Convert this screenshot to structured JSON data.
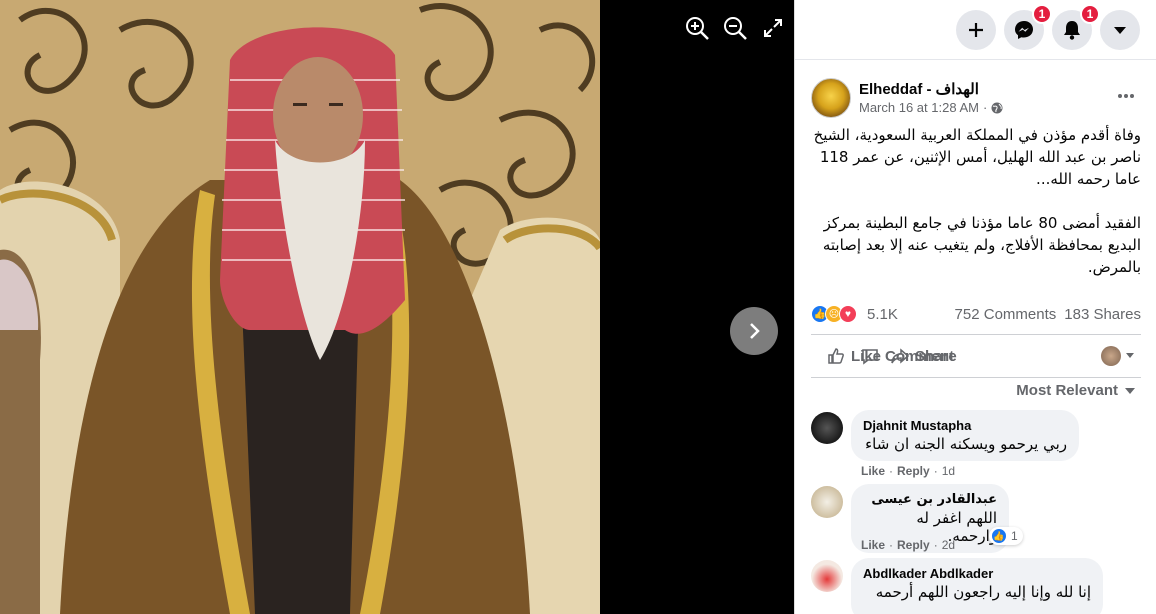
{
  "viewer": {
    "zoom_in_label": "zoom in",
    "zoom_out_label": "zoom out",
    "fullscreen_label": "fullscreen",
    "next_label": "next photo"
  },
  "topbar": {
    "messenger_badge": "1",
    "notifications_badge": "1"
  },
  "post": {
    "page_name": "Elheddaf - الهداف",
    "time": "March 16 at 1:28 AM",
    "separator": "·",
    "paragraphs": [
      "وفاة أقدم مؤذن في المملكة العربية السعودية، الشيخ ناصر بن عبد الله الهليل، أمس الإثنين، عن عمر 118 عاما رحمه الله...",
      "الفقيد أمضى 80 عاما مؤذنا في جامع البطينة بمركز البديع بمحافظة الأفلاج، ولم يتغيب عنه إلا بعد إصابته بالمرض."
    ],
    "reactions_count": "5.1K",
    "comments_count": "752 Comments",
    "shares_count": "183 Shares"
  },
  "actions": {
    "like": "Like",
    "comment": "Comment",
    "share": "Share"
  },
  "sort_label": "Most Relevant",
  "comments": [
    {
      "name": "Djahnit Mustapha",
      "text": "ربي يرحمو ويسكنه الجنه ان شاء",
      "like": "Like",
      "reply": "Reply",
      "time": "1d"
    },
    {
      "name": "عبدالقادر بن عيسى",
      "text": "اللهم اغفر له وارحمه.",
      "like": "Like",
      "reply": "Reply",
      "time": "2d",
      "reaction_count": "1"
    },
    {
      "name": "Abdlkader Abdlkader",
      "text": "إنا لله وإنا إليه راجعون اللهم أرحمه"
    }
  ],
  "colors": {
    "accent": "#1877f2",
    "badge": "#e41e3f",
    "secondary_text": "#65676b"
  }
}
